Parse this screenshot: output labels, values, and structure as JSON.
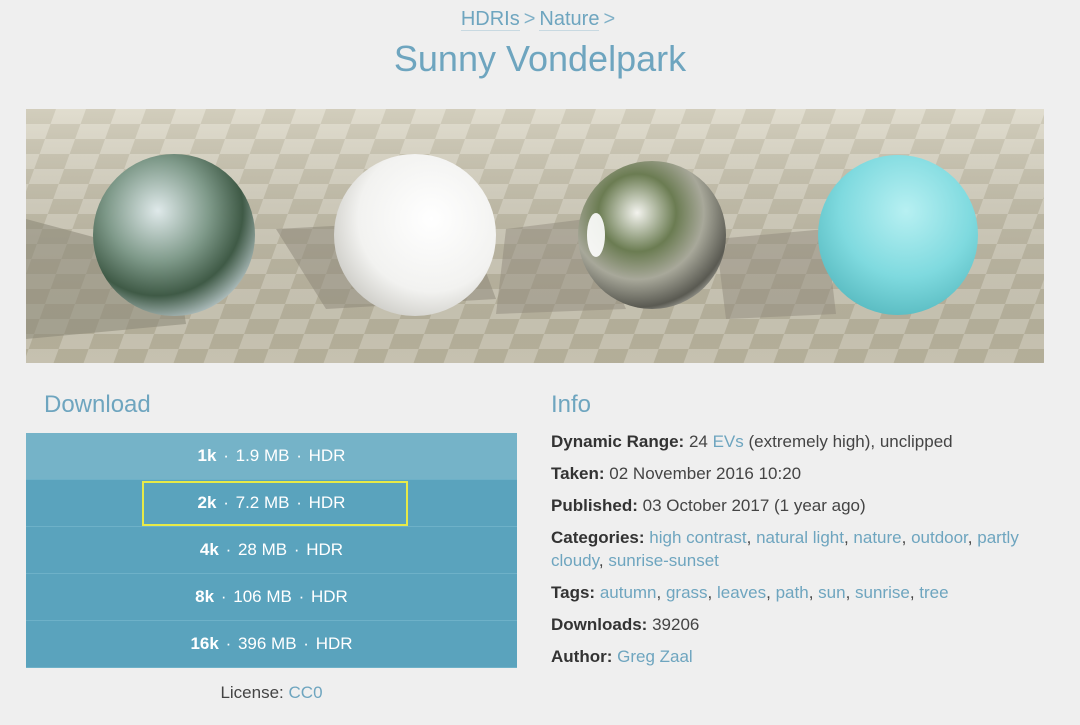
{
  "breadcrumb": {
    "items": [
      "HDRIs",
      "Nature"
    ],
    "separator": ">"
  },
  "page_title": "Sunny Vondelpark",
  "download": {
    "heading": "Download",
    "options": [
      {
        "res": "1k",
        "size": "1.9 MB",
        "format": "HDR"
      },
      {
        "res": "2k",
        "size": "7.2 MB",
        "format": "HDR"
      },
      {
        "res": "4k",
        "size": "28 MB",
        "format": "HDR"
      },
      {
        "res": "8k",
        "size": "106 MB",
        "format": "HDR"
      },
      {
        "res": "16k",
        "size": "396 MB",
        "format": "HDR"
      }
    ],
    "license_label": "License:",
    "license_value": "CC0"
  },
  "info": {
    "heading": "Info",
    "dynamic_range_label": "Dynamic Range:",
    "dynamic_range_value": "24",
    "dynamic_range_link": "EVs",
    "dynamic_range_note": "(extremely high), unclipped",
    "taken_label": "Taken:",
    "taken_value": "02 November 2016 10:20",
    "published_label": "Published:",
    "published_value": "03 October 2017 (1 year ago)",
    "categories_label": "Categories:",
    "categories": [
      "high contrast",
      "natural light",
      "nature",
      "outdoor",
      "partly cloudy",
      "sunrise-sunset"
    ],
    "tags_label": "Tags:",
    "tags": [
      "autumn",
      "grass",
      "leaves",
      "path",
      "sun",
      "sunrise",
      "tree"
    ],
    "downloads_label": "Downloads:",
    "downloads_value": "39206",
    "author_label": "Author:",
    "author_value": "Greg Zaal"
  },
  "colors": {
    "accent": "#6ea5bf",
    "download_row": "#5aa3bd",
    "download_row_hover": "#75b3c8",
    "selection_outline": "#e7ea47",
    "background": "#efefef"
  }
}
